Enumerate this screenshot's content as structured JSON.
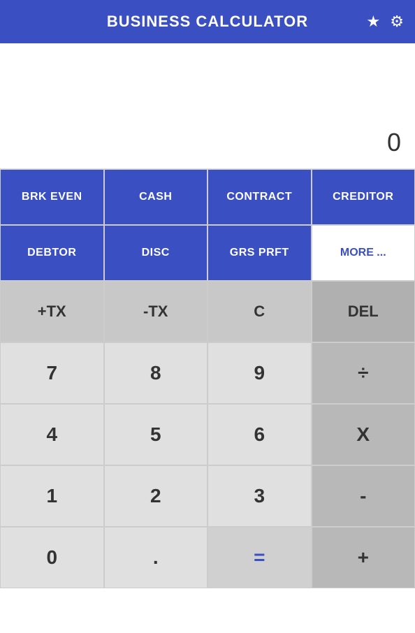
{
  "header": {
    "title": "BUSINESS CALCULATOR",
    "star_icon": "★",
    "settings_icon": "⚙"
  },
  "display": {
    "value": "0"
  },
  "buttons": {
    "row1": [
      {
        "label": "BRK EVEN",
        "type": "blue"
      },
      {
        "label": "CASH",
        "type": "blue"
      },
      {
        "label": "CONTRACT",
        "type": "blue"
      },
      {
        "label": "CREDITOR",
        "type": "blue"
      }
    ],
    "row2": [
      {
        "label": "DEBTOR",
        "type": "blue"
      },
      {
        "label": "DISC",
        "type": "blue"
      },
      {
        "label": "GRS PRFT",
        "type": "blue"
      },
      {
        "label": "MORE ...",
        "type": "more"
      }
    ],
    "row3": [
      {
        "label": "+TX",
        "type": "light-gray"
      },
      {
        "label": "-TX",
        "type": "light-gray"
      },
      {
        "label": "C",
        "type": "light-gray"
      },
      {
        "label": "DEL",
        "type": "del"
      }
    ],
    "row4": [
      {
        "label": "7",
        "type": "num"
      },
      {
        "label": "8",
        "type": "num"
      },
      {
        "label": "9",
        "type": "num"
      },
      {
        "label": "÷",
        "type": "op"
      }
    ],
    "row5": [
      {
        "label": "4",
        "type": "num"
      },
      {
        "label": "5",
        "type": "num"
      },
      {
        "label": "6",
        "type": "num"
      },
      {
        "label": "X",
        "type": "op"
      }
    ],
    "row6": [
      {
        "label": "1",
        "type": "num"
      },
      {
        "label": "2",
        "type": "num"
      },
      {
        "label": "3",
        "type": "num"
      },
      {
        "label": "-",
        "type": "op"
      }
    ],
    "row7": [
      {
        "label": "0",
        "type": "num"
      },
      {
        "label": ".",
        "type": "num"
      },
      {
        "label": "=",
        "type": "eq"
      },
      {
        "label": "+",
        "type": "plus"
      }
    ]
  }
}
